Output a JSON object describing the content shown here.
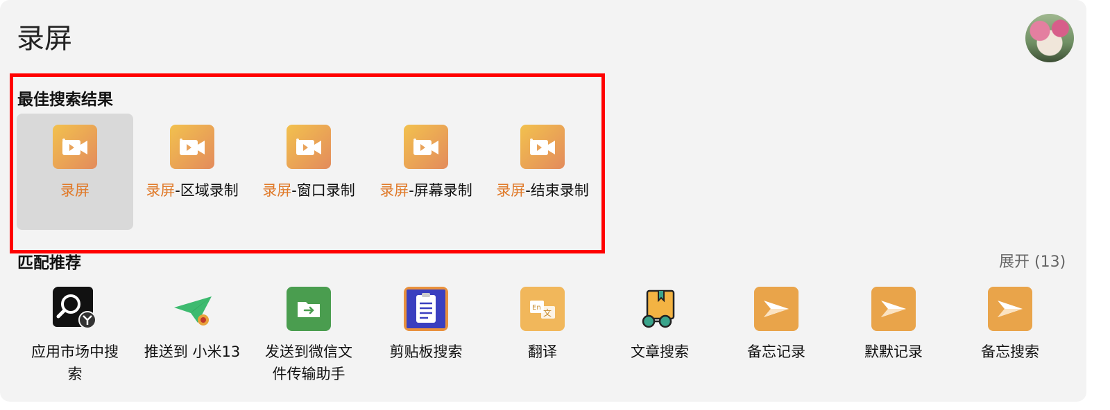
{
  "search": {
    "query": "录屏"
  },
  "best": {
    "title": "最佳搜索结果",
    "items": [
      {
        "highlight": "录屏",
        "rest": "",
        "icon": "screen-record-icon"
      },
      {
        "highlight": "录屏",
        "rest": "-区域录制",
        "icon": "screen-record-icon"
      },
      {
        "highlight": "录屏",
        "rest": "-窗口录制",
        "icon": "screen-record-icon"
      },
      {
        "highlight": "录屏",
        "rest": "-屏幕录制",
        "icon": "screen-record-icon"
      },
      {
        "highlight": "录屏",
        "rest": "-结束录制",
        "icon": "screen-record-icon"
      }
    ]
  },
  "match": {
    "title": "匹配推荐",
    "expand_label": "展开 (13)",
    "items": [
      {
        "label": "应用市场中搜索",
        "icon": "app-market-search-icon"
      },
      {
        "label": "推送到 小米13",
        "icon": "paper-plane-icon"
      },
      {
        "label": "发送到微信文件传输助手",
        "icon": "folder-send-icon"
      },
      {
        "label": "剪贴板搜索",
        "icon": "clipboard-icon"
      },
      {
        "label": "翻译",
        "icon": "translate-icon"
      },
      {
        "label": "文章搜索",
        "icon": "article-glasses-icon"
      },
      {
        "label": "备忘记录",
        "icon": "memo-arrow-icon"
      },
      {
        "label": "默默记录",
        "icon": "memo-arrow-icon"
      },
      {
        "label": "备忘搜索",
        "icon": "memo-arrow-icon"
      }
    ]
  },
  "colors": {
    "accent": "#e07a2a",
    "highlight_frame": "#ff0000",
    "selected_bg": "#d9d9d9"
  }
}
